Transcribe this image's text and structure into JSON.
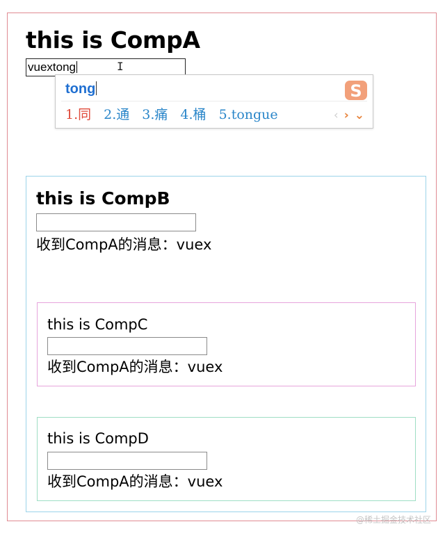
{
  "compA": {
    "title": "this is CompA",
    "input_value": "vuextong"
  },
  "ime": {
    "pinyin": "tong",
    "candidates": [
      "1.同",
      "2.通",
      "3.痛",
      "4.桶",
      "5.tongue"
    ],
    "prev_symbol": "‹",
    "next_symbol": "›",
    "more_symbol": "⌄",
    "logo_letter": "S",
    "colors": {
      "pinyin": "#1f6fd1",
      "first_candidate": "#e04a3a",
      "candidate": "#2a86c9",
      "accent": "#e8843c"
    }
  },
  "compB": {
    "title": "this is CompB",
    "input_value": "",
    "message": "收到CompA的消息：vuex"
  },
  "compC": {
    "title": "this is CompC",
    "input_value": "",
    "message": "收到CompA的消息：vuex"
  },
  "compD": {
    "title": "this is CompD",
    "input_value": "",
    "message": "收到CompA的消息：vuex"
  },
  "watermark": "@稀土掘金技术社区",
  "border_colors": {
    "compA": "#e08a92",
    "compB": "#9bd3ea",
    "compC": "#e7a3dc",
    "compD": "#9edec4"
  }
}
